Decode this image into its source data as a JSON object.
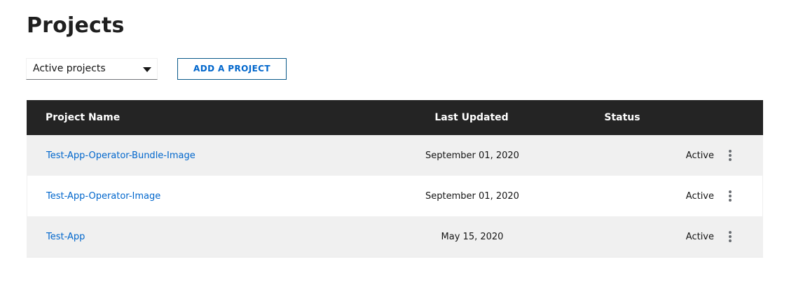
{
  "page": {
    "title": "Projects"
  },
  "toolbar": {
    "filter_value": "Active projects",
    "add_button_label": "ADD A PROJECT"
  },
  "table": {
    "columns": {
      "name": "Project Name",
      "updated": "Last Updated",
      "status": "Status"
    },
    "rows": [
      {
        "name": "Test-App-Operator-Bundle-Image",
        "updated": "September 01, 2020",
        "status": "Active"
      },
      {
        "name": "Test-App-Operator-Image",
        "updated": "September 01, 2020",
        "status": "Active"
      },
      {
        "name": "Test-App",
        "updated": "May 15, 2020",
        "status": "Active"
      }
    ]
  },
  "icons": {
    "filter_caret": "caret-down-icon",
    "row_actions": "kebab-menu-icon"
  },
  "colors": {
    "link": "#0066cc",
    "header_bg": "#242424",
    "row_shade": "#f0f0f0"
  }
}
